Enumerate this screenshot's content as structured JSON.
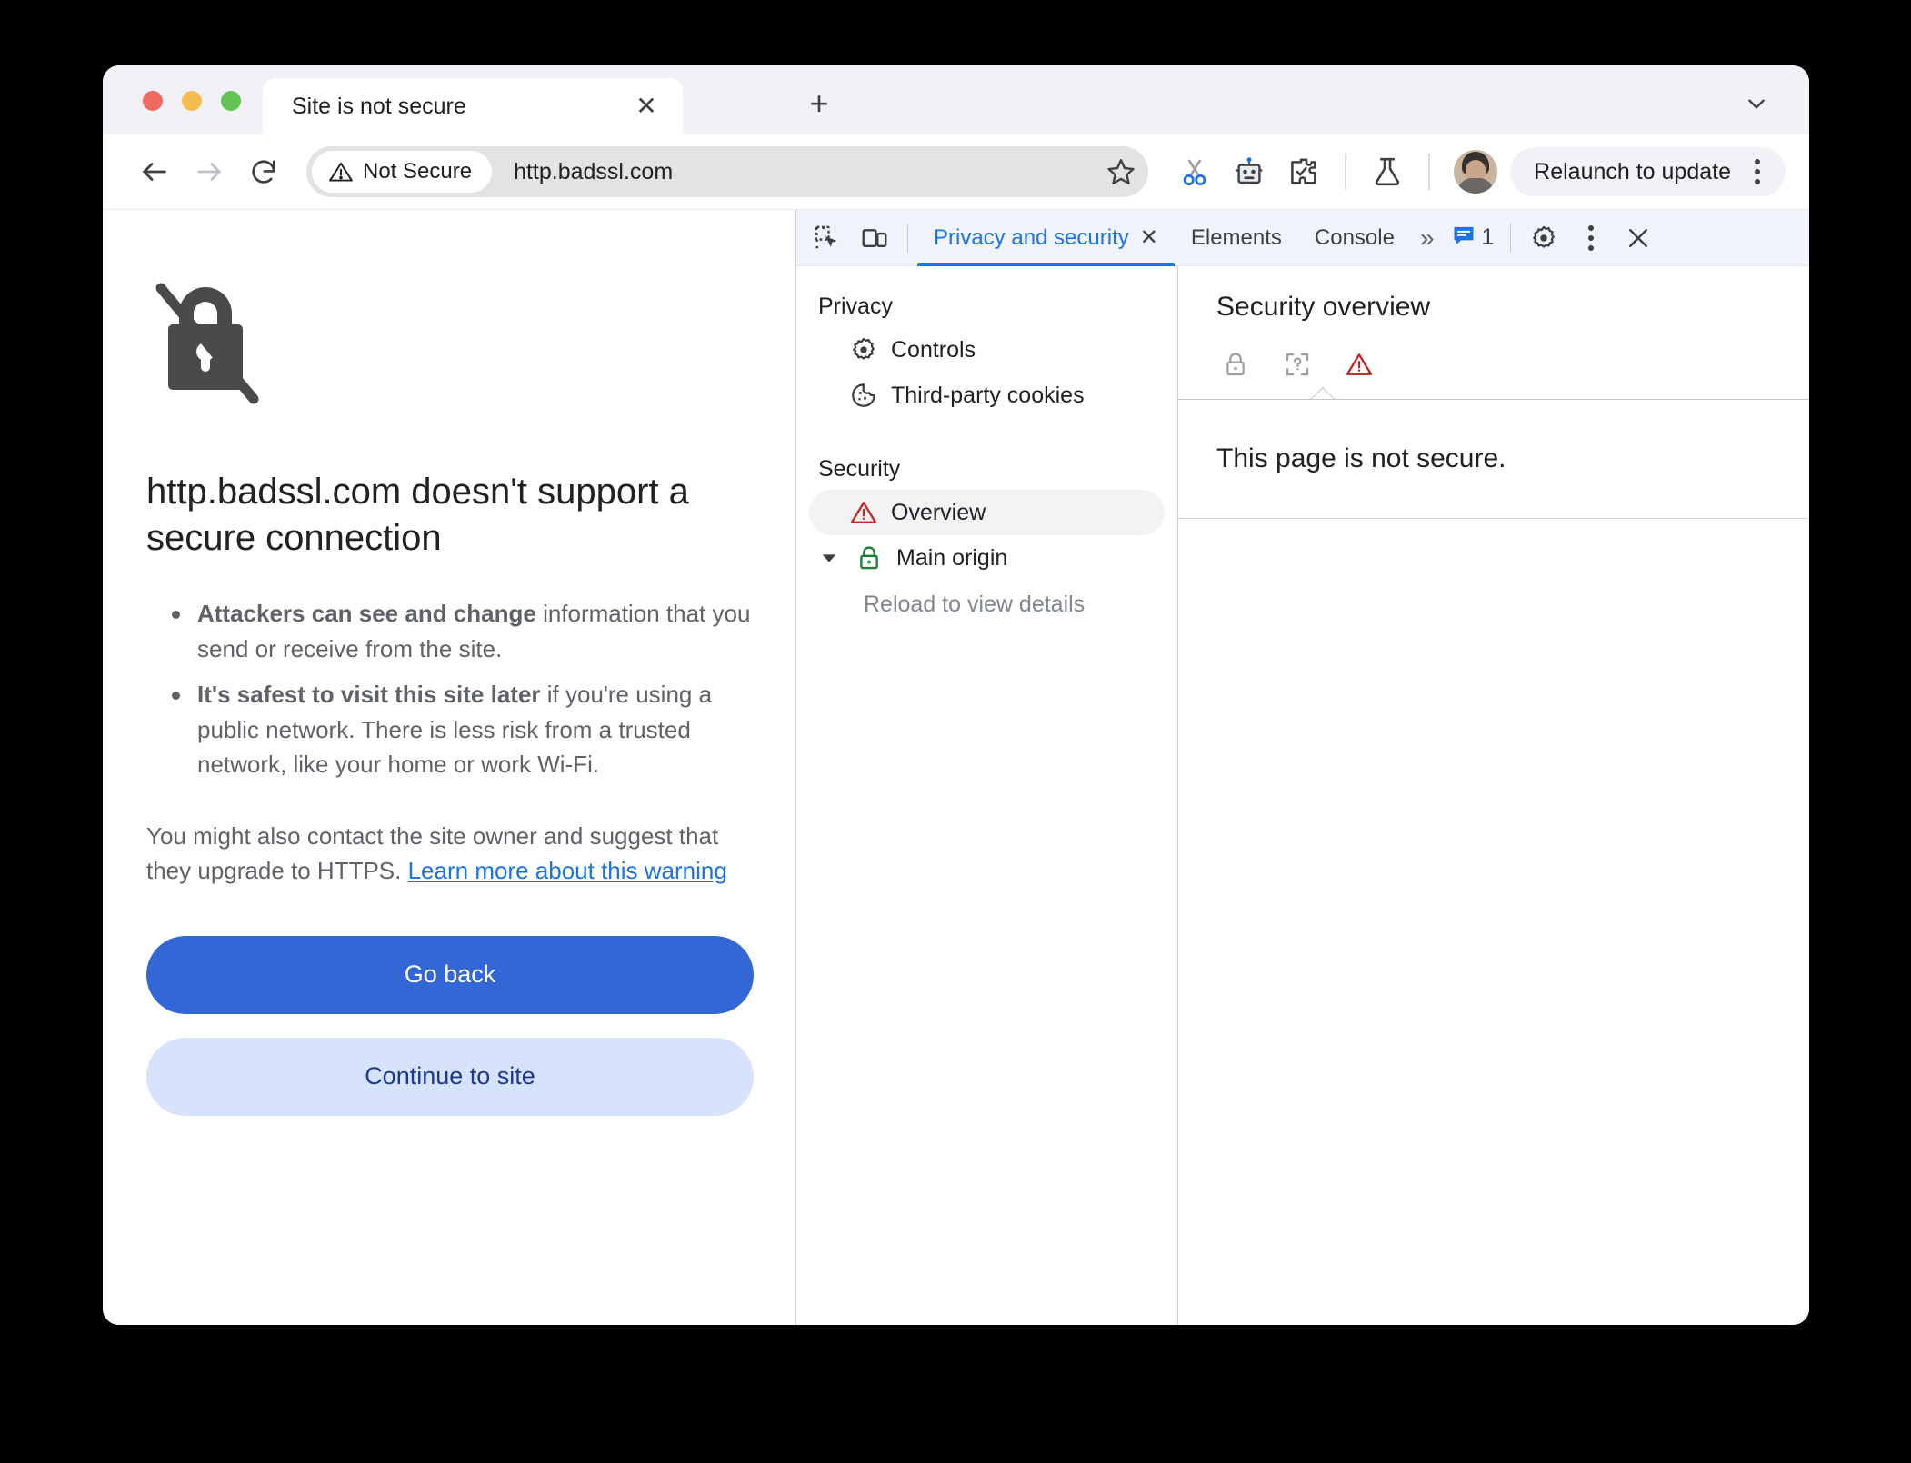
{
  "window": {
    "traffic_lights": [
      "close",
      "minimize",
      "zoom"
    ],
    "colors": {
      "close": "#ee6a5f",
      "minimize": "#f5bd4f",
      "zoom": "#61c454",
      "accent_blue": "#1a73e8",
      "primary_button": "#3367d6",
      "secondary_button": "#d7e3fc",
      "warning_red": "#c5221f",
      "secure_green": "#188038"
    }
  },
  "tabstrip": {
    "tab_title": "Site is not secure",
    "close_glyph": "✕",
    "new_tab_glyph": "+",
    "tab_search_icon": "chevron-down-icon"
  },
  "toolbar": {
    "back_icon": "back-arrow-icon",
    "forward_icon": "forward-arrow-icon",
    "reload_icon": "reload-icon",
    "security_chip_label": "Not Secure",
    "security_chip_icon": "warning-triangle-icon",
    "url": "http.badssl.com",
    "bookmark_icon": "star-icon",
    "icons": [
      "scissors-icon",
      "robot-icon",
      "extensions-puzzle-icon",
      "lab-flask-icon"
    ],
    "profile_avatar": "avatar",
    "relaunch_label": "Relaunch to update",
    "menu_icon": "kebab-menu-icon"
  },
  "page": {
    "lock_icon": "broken-lock-icon",
    "heading": "http.badssl.com doesn't support a secure connection",
    "bullets": [
      {
        "bold": "Attackers can see and change",
        "rest": " information that you send or receive from the site."
      },
      {
        "bold": "It's safest to visit this site later",
        "rest": " if you're using a public network. There is less risk from a trusted network, like your home or work Wi-Fi."
      }
    ],
    "paragraph_prefix": "You might also contact the site owner and suggest that they upgrade to HTTPS. ",
    "paragraph_link": "Learn more about this warning",
    "primary_button": "Go back",
    "secondary_button": "Continue to site"
  },
  "devtools": {
    "inspect_icon": "inspect-element-icon",
    "device_toolbar_icon": "device-toolbar-icon",
    "tabs": [
      {
        "label": "Privacy and security",
        "active": true,
        "closeable": true
      },
      {
        "label": "Elements",
        "active": false,
        "closeable": false
      },
      {
        "label": "Console",
        "active": false,
        "closeable": false
      }
    ],
    "tab_close_glyph": "✕",
    "more_tabs_glyph": "»",
    "issues_icon": "issues-message-icon",
    "issues_count": "1",
    "settings_icon": "gear-icon",
    "more_options_icon": "kebab-menu-icon",
    "close_icon": "close-icon",
    "sidebar": {
      "groups": [
        {
          "title": "Privacy",
          "items": [
            {
              "label": "Controls",
              "icon": "gear-icon",
              "selected": false,
              "expandable": false
            },
            {
              "label": "Third-party cookies",
              "icon": "cookie-icon",
              "selected": false,
              "expandable": false
            }
          ]
        },
        {
          "title": "Security",
          "items": [
            {
              "label": "Overview",
              "icon": "warning-triangle-icon",
              "selected": true,
              "expandable": false
            },
            {
              "label": "Main origin",
              "icon": "lock-icon",
              "selected": false,
              "expandable": true
            }
          ]
        }
      ],
      "origin_subtext": "Reload to view details"
    },
    "overview": {
      "title": "Security overview",
      "status_icons": [
        "lock-icon",
        "certificate-unknown-icon",
        "warning-triangle-icon"
      ],
      "active_status_index": 2,
      "summary": "This page is not secure."
    }
  }
}
